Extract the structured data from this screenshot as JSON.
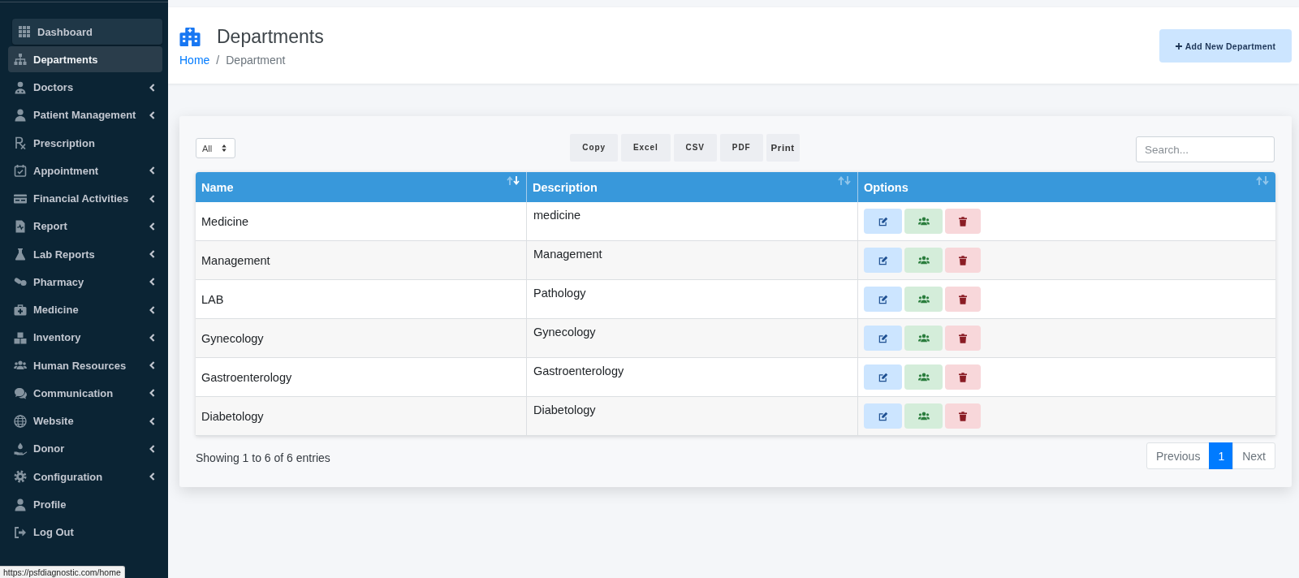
{
  "sidebar": {
    "items": [
      {
        "label": "Dashboard",
        "selected": false,
        "hovered": true,
        "has_submenu": false
      },
      {
        "label": "Departments",
        "selected": true,
        "hovered": false,
        "has_submenu": false
      },
      {
        "label": "Doctors",
        "selected": false,
        "hovered": false,
        "has_submenu": true
      },
      {
        "label": "Patient Management",
        "selected": false,
        "hovered": false,
        "has_submenu": true
      },
      {
        "label": "Prescription",
        "selected": false,
        "hovered": false,
        "has_submenu": false
      },
      {
        "label": "Appointment",
        "selected": false,
        "hovered": false,
        "has_submenu": true
      },
      {
        "label": "Financial Activities",
        "selected": false,
        "hovered": false,
        "has_submenu": true
      },
      {
        "label": "Report",
        "selected": false,
        "hovered": false,
        "has_submenu": true
      },
      {
        "label": "Lab Reports",
        "selected": false,
        "hovered": false,
        "has_submenu": true
      },
      {
        "label": "Pharmacy",
        "selected": false,
        "hovered": false,
        "has_submenu": true
      },
      {
        "label": "Medicine",
        "selected": false,
        "hovered": false,
        "has_submenu": true
      },
      {
        "label": "Inventory",
        "selected": false,
        "hovered": false,
        "has_submenu": true
      },
      {
        "label": "Human Resources",
        "selected": false,
        "hovered": false,
        "has_submenu": true
      },
      {
        "label": "Communication",
        "selected": false,
        "hovered": false,
        "has_submenu": true
      },
      {
        "label": "Website",
        "selected": false,
        "hovered": false,
        "has_submenu": true
      },
      {
        "label": "Donor",
        "selected": false,
        "hovered": false,
        "has_submenu": true
      },
      {
        "label": "Configuration",
        "selected": false,
        "hovered": false,
        "has_submenu": true
      },
      {
        "label": "Profile",
        "selected": false,
        "hovered": false,
        "has_submenu": false
      },
      {
        "label": "Log Out",
        "selected": false,
        "hovered": false,
        "has_submenu": false
      }
    ]
  },
  "header": {
    "title": "Departments",
    "breadcrumb": [
      {
        "label": "Home",
        "kind": "link"
      },
      {
        "label": "Department",
        "kind": "current"
      }
    ],
    "breadcrumb_separator": "/",
    "add_button": "Add New Department"
  },
  "toolbar": {
    "page_length": "All",
    "export_buttons": [
      "Copy",
      "Excel",
      "CSV",
      "PDF",
      "Print"
    ],
    "search": {
      "placeholder": "Search..."
    }
  },
  "table": {
    "columns": [
      {
        "label": "Name",
        "sorted": true
      },
      {
        "label": "Description",
        "sorted": false
      },
      {
        "label": "Options",
        "sorted": false
      }
    ],
    "rows": [
      {
        "name": "Medicine",
        "description": "medicine"
      },
      {
        "name": "Management",
        "description": "Management"
      },
      {
        "name": "LAB",
        "description": "Pathology"
      },
      {
        "name": "Gynecology",
        "description": "Gynecology"
      },
      {
        "name": "Gastroenterology",
        "description": "Gastroenterology"
      },
      {
        "name": "Diabetology",
        "description": "Diabetology"
      }
    ]
  },
  "footer": {
    "info": "Showing 1 to 6 of 6 entries",
    "pagination": {
      "previous": {
        "label": "Previous",
        "disabled": true
      },
      "pages": [
        {
          "label": "1",
          "selected": true
        }
      ],
      "next": {
        "label": "Next",
        "disabled": true
      }
    }
  },
  "status_bar": {
    "url": "https://psfdiagnostic.com/home"
  }
}
